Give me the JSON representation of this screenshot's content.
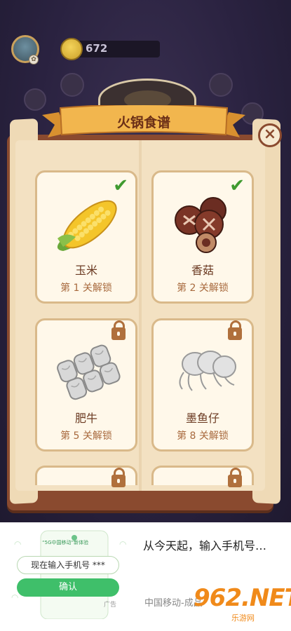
{
  "hud": {
    "coins": "672",
    "avatar_badge": "✿"
  },
  "recipe_book": {
    "title": "火锅食谱",
    "close_label": "×",
    "cards": [
      {
        "name": "玉米",
        "unlock": "第 1 关解锁",
        "status": "unlocked",
        "icon": "corn-icon"
      },
      {
        "name": "香菇",
        "unlock": "第 2 关解锁",
        "status": "unlocked",
        "icon": "mushroom-icon"
      },
      {
        "name": "肥牛",
        "unlock": "第 5 关解锁",
        "status": "locked",
        "icon": "beef-roll-icon"
      },
      {
        "name": "墨鱼仔",
        "unlock": "第 8 关解锁",
        "status": "locked",
        "icon": "baby-squid-icon"
      }
    ],
    "check_glyph": "✔"
  },
  "ad": {
    "tiny_text": "“5G中国移动”新体验",
    "input_text": "现在输入手机号 ***",
    "button_label": "确认",
    "tag": "广告",
    "headline": "从今天起，输入手机号…",
    "source": "中国移动-成品",
    "watermark": "962.NET",
    "watermark_sub": "乐游网"
  },
  "colors": {
    "book_frame": "#8a4a2f",
    "paper": "#f3e1c2",
    "ribbon": "#f2b64e",
    "check": "#3f9a2f",
    "lock": "#b0703c",
    "ad_button": "#3fbf6a"
  }
}
